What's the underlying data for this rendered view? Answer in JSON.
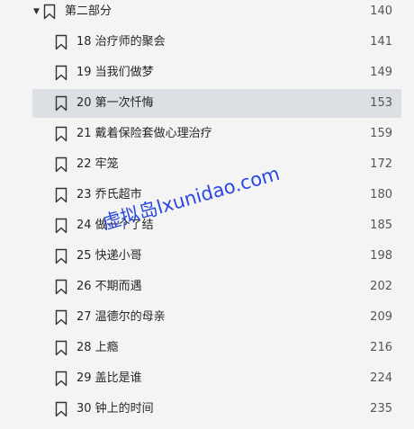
{
  "toc": {
    "parent": {
      "title": "第二部分",
      "page": "140",
      "icon": "bookmark-icon",
      "expanded": true
    },
    "items": [
      {
        "title": "18 治疗师的聚会",
        "page": "141"
      },
      {
        "title": "19 当我们做梦",
        "page": "149"
      },
      {
        "title": "20 第一次忏悔",
        "page": "153",
        "selected": true
      },
      {
        "title": "21 戴着保险套做心理治疗",
        "page": "159"
      },
      {
        "title": "22 牢笼",
        "page": "172"
      },
      {
        "title": "23 乔氏超市",
        "page": "180"
      },
      {
        "title": "24 做一个了结",
        "page": "185"
      },
      {
        "title": "25 快递小哥",
        "page": "198"
      },
      {
        "title": "26 不期而遇",
        "page": "202"
      },
      {
        "title": "27 温德尔的母亲",
        "page": "209"
      },
      {
        "title": "28 上瘾",
        "page": "216"
      },
      {
        "title": "29 盖比是谁",
        "page": "224"
      },
      {
        "title": "30 钟上的时间",
        "page": "235"
      }
    ]
  },
  "watermark": {
    "text": "虚拟岛lxunidao.com",
    "color": "#1f3fe0"
  },
  "colors": {
    "background": "#f4f4f4",
    "selected_row": "#dcdfe3",
    "icon_stroke": "#333333"
  }
}
